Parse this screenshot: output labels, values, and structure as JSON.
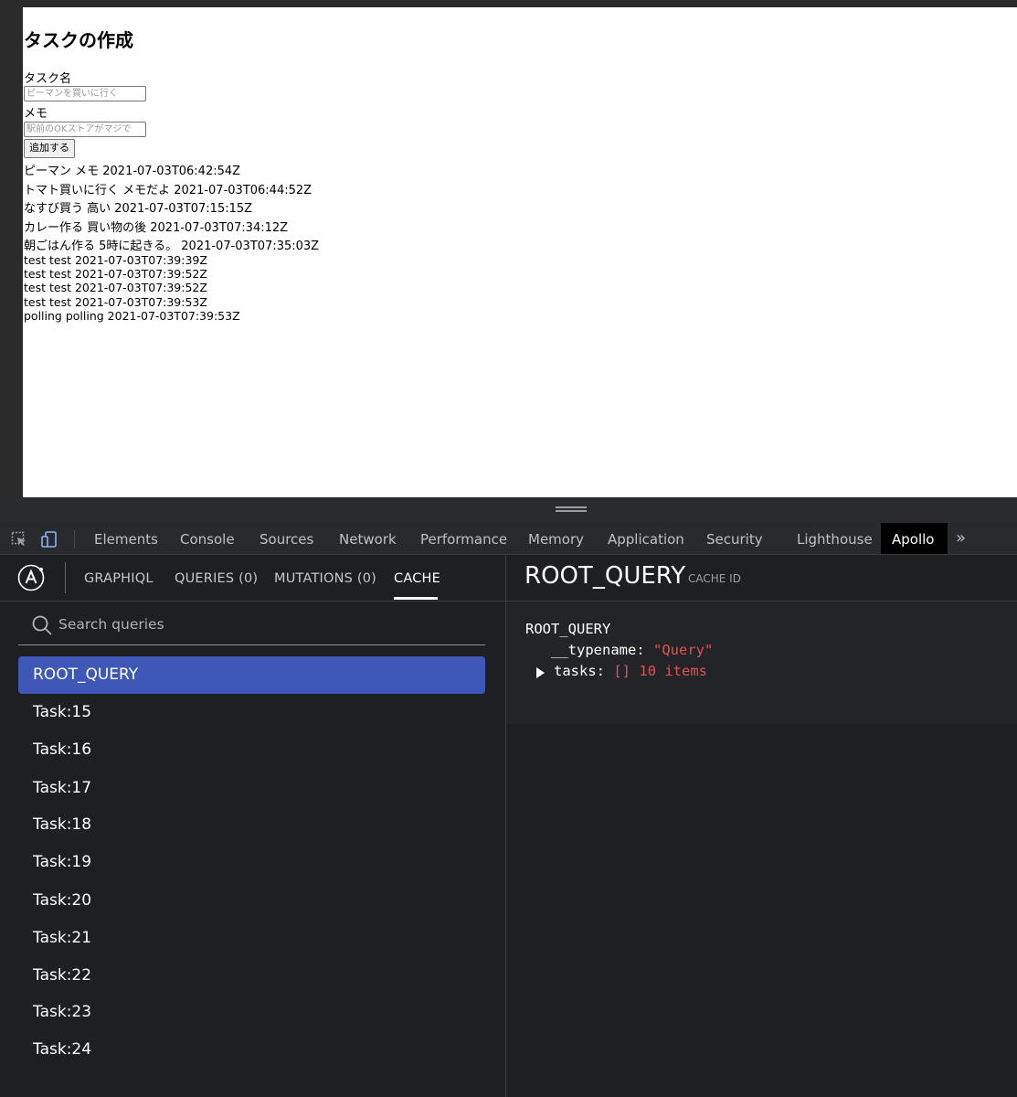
{
  "page": {
    "heading": "タスクの作成",
    "task_name_label": "タスク名",
    "task_name_placeholder": "ピーマンを買いに行く",
    "memo_label": "メモ",
    "memo_placeholder": "駅前のOKストアがマジで",
    "add_button": "追加する",
    "tasks": [
      "ピーマン メモ 2021-07-03T06:42:54Z",
      "トマト買いに行く メモだよ 2021-07-03T06:44:52Z",
      "なすび買う 高い 2021-07-03T07:15:15Z",
      "カレー作る 買い物の後 2021-07-03T07:34:12Z",
      "朝ごはん作る 5時に起きる。 2021-07-03T07:35:03Z",
      "test test 2021-07-03T07:39:39Z",
      "test test 2021-07-03T07:39:52Z",
      "test test 2021-07-03T07:39:52Z",
      "test test 2021-07-03T07:39:53Z",
      "polling polling 2021-07-03T07:39:53Z"
    ]
  },
  "devtools": {
    "tabs": [
      "Elements",
      "Console",
      "Sources",
      "Network",
      "Performance",
      "Memory",
      "Application",
      "Security",
      "Lighthouse",
      "Apollo"
    ],
    "active_tab": "Apollo",
    "more": "»",
    "icons": [
      "inspect-element-icon",
      "device-toolbar-icon"
    ]
  },
  "apollo": {
    "nav": {
      "graphiql": "GRAPHIQL",
      "queries": "QUERIES (0)",
      "mutations": "MUTATIONS (0)",
      "cache": "CACHE",
      "active": "CACHE"
    },
    "search_placeholder": "Search queries",
    "cache_keys": [
      "ROOT_QUERY",
      "Task:15",
      "Task:16",
      "Task:17",
      "Task:18",
      "Task:19",
      "Task:20",
      "Task:21",
      "Task:22",
      "Task:23",
      "Task:24"
    ],
    "selected_key": "ROOT_QUERY",
    "detail": {
      "title": "ROOT_QUERY",
      "cache_id_label": "CACHE ID",
      "root": "ROOT_QUERY",
      "typename_key": "__typename:",
      "typename_value": "\"Query\"",
      "tasks_key": "tasks:",
      "tasks_brackets": "[]",
      "tasks_count": "10 items"
    },
    "colors": {
      "selected_bg": "#3f57b6",
      "string_red": "#e05252"
    }
  }
}
